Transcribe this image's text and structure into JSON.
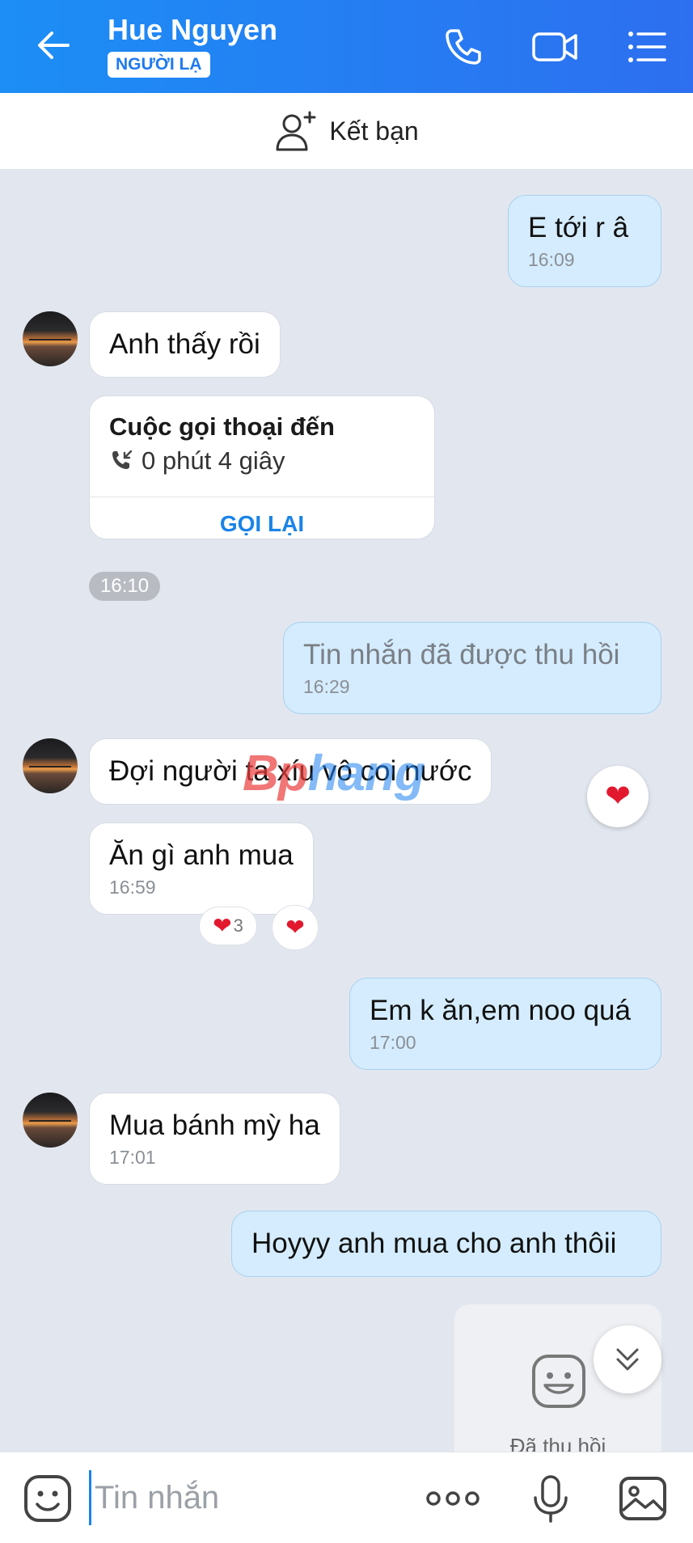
{
  "header": {
    "contact_name": "Hue Nguyen",
    "badge": "NGƯỜI LẠ",
    "icons": [
      "back-arrow-icon",
      "phone-icon",
      "video-camera-icon",
      "list-menu-icon"
    ]
  },
  "friend_bar": {
    "label": "Kết bạn",
    "icon": "add-person-icon"
  },
  "messages": [
    {
      "from": "me",
      "text": "E tới r â",
      "time": "16:09"
    },
    {
      "from": "them",
      "text": "Anh thấy rồi"
    },
    {
      "from": "them",
      "type": "call",
      "title": "Cuộc gọi thoại đến",
      "duration": "0 phút 4 giây",
      "action": "GỌI LẠI"
    },
    {
      "from": "them",
      "type": "time-chip",
      "time": "16:10"
    },
    {
      "from": "me",
      "text": "Tin nhắn đã được thu hồi",
      "time": "16:29"
    },
    {
      "from": "them",
      "text": "Đợi người ta xíu vô coi nước"
    },
    {
      "from": "them",
      "text": "Ăn gì anh mua",
      "time": "16:59",
      "reaction_count": "3"
    },
    {
      "from": "me",
      "text": "Em k ăn,em noo quá",
      "time": "17:00"
    },
    {
      "from": "them",
      "text": "Mua bánh mỳ ha",
      "time": "17:01"
    },
    {
      "from": "me",
      "text": "Hoyyy anh mua cho anh thôii"
    },
    {
      "from": "me",
      "type": "recalled-sticker",
      "caption": "Đã thu hồi"
    }
  ],
  "watermark": {
    "part1": "Bp",
    "part2": "hang"
  },
  "input": {
    "placeholder": "Tin nhắn"
  },
  "colors": {
    "header": "#1c8ef5",
    "outgoing_bubble": "#d4ecfd",
    "incoming_bubble": "#ffffff",
    "accent": "#1a84e8",
    "heart": "#e2192e"
  }
}
